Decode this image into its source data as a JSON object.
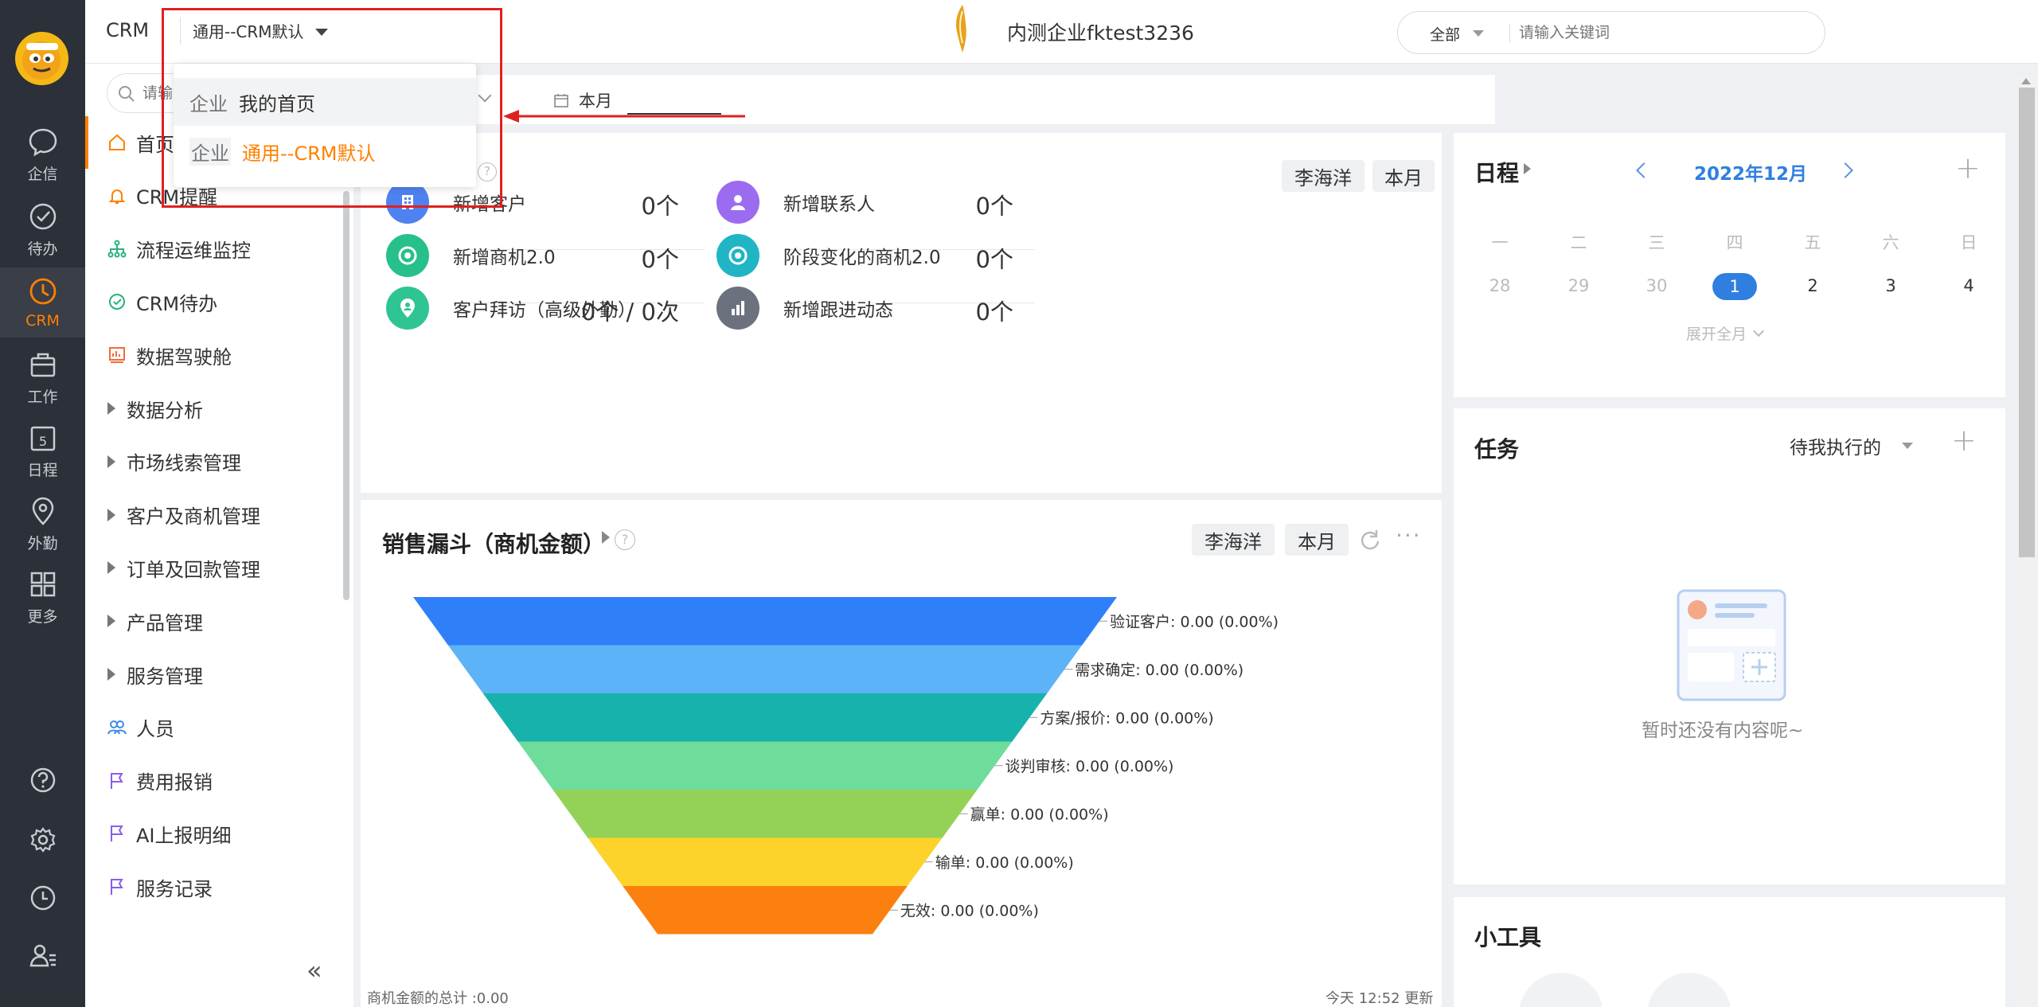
{
  "rail": {
    "items": [
      {
        "label": "企信",
        "icon": "chat-bubble-icon"
      },
      {
        "label": "待办",
        "icon": "check-circle-icon"
      },
      {
        "label": "CRM",
        "icon": "clock-icon"
      },
      {
        "label": "工作",
        "icon": "briefcase-icon"
      },
      {
        "label": "日程",
        "icon": "calendar-icon",
        "badge": "5"
      },
      {
        "label": "外勤",
        "icon": "location-pin-icon"
      },
      {
        "label": "更多",
        "icon": "grid-icon"
      }
    ],
    "active": "CRM",
    "active_color": "#ff8000"
  },
  "topbar": {
    "app_name": "CRM",
    "view_selector": "通用--CRM默认",
    "company": "内测企业fktest3236",
    "search_scope": "全部",
    "search_placeholder": "请输入关键词"
  },
  "dropdown": {
    "items": [
      {
        "tag": "企业",
        "label": "我的首页",
        "selected": false
      },
      {
        "tag": "企业",
        "label": "通用--CRM默认",
        "selected": true
      }
    ],
    "highlight_color": "#e02020"
  },
  "filterbar": {
    "search_placeholder": "请输",
    "date_label": "本月"
  },
  "menu": {
    "items": [
      {
        "label": "首页",
        "icon": "home-icon",
        "expandable": false
      },
      {
        "label": "CRM提醒",
        "icon": "bell-icon",
        "expandable": false
      },
      {
        "label": "流程运维监控",
        "icon": "flow-tree-icon",
        "expandable": false
      },
      {
        "label": "CRM待办",
        "icon": "check-circle-icon",
        "expandable": false
      },
      {
        "label": "数据驾驶舱",
        "icon": "dashboard-icon",
        "expandable": false
      },
      {
        "label": "数据分析",
        "expandable": true
      },
      {
        "label": "市场线索管理",
        "expandable": true
      },
      {
        "label": "客户及商机管理",
        "expandable": true
      },
      {
        "label": "订单及回款管理",
        "expandable": true
      },
      {
        "label": "产品管理",
        "expandable": true
      },
      {
        "label": "服务管理",
        "expandable": true
      },
      {
        "label": "人员",
        "icon": "people-icon",
        "expandable": false
      },
      {
        "label": "费用报销",
        "icon": "flag-icon",
        "expandable": false
      },
      {
        "label": "AI上报明细",
        "icon": "flag-icon",
        "expandable": false
      },
      {
        "label": "服务记录",
        "icon": "flag-icon",
        "expandable": false
      }
    ],
    "collapse_glyph": "«"
  },
  "overview": {
    "owner": "李海洋",
    "period": "本月",
    "stats": [
      {
        "label": "新增客户",
        "value": "0个",
        "icon": "building-icon",
        "color": "#4f82f0"
      },
      {
        "label": "新增联系人",
        "value": "0个",
        "icon": "person-icon",
        "color": "#9b6cf0"
      },
      {
        "label": "新增商机2.0",
        "value": "0个",
        "icon": "target-icon",
        "color": "#27c08a"
      },
      {
        "label": "阶段变化的商机2.0",
        "value": "0个",
        "icon": "target-icon",
        "color": "#1fb5c5"
      },
      {
        "label": "客户拜访（高级外勤）",
        "value": "0个 / 0次",
        "icon": "location-person-icon",
        "color": "#2fc493"
      },
      {
        "label": "新增跟进动态",
        "value": "0个",
        "icon": "bar-chart-icon",
        "color": "#6c7180"
      }
    ]
  },
  "funnel": {
    "title": "销售漏斗（商机金额）",
    "owner": "李海洋",
    "period": "本月",
    "stages": [
      {
        "label": "验证客户",
        "value": "0.00 (0.00%)",
        "color": "#2f80f8"
      },
      {
        "label": "需求确定",
        "value": "0.00 (0.00%)",
        "color": "#5cb3f7"
      },
      {
        "label": "方案/报价",
        "value": "0.00 (0.00%)",
        "color": "#17b2ac"
      },
      {
        "label": "谈判审核",
        "value": "0.00 (0.00%)",
        "color": "#6edc9b"
      },
      {
        "label": "赢单",
        "value": "0.00 (0.00%)",
        "color": "#93d257"
      },
      {
        "label": "输单",
        "value": "0.00 (0.00%)",
        "color": "#fdd22b"
      },
      {
        "label": "无效",
        "value": "0.00 (0.00%)",
        "color": "#fb8010"
      }
    ],
    "total": "商机金额的总计 :0.00",
    "updated": "今天 12:52 更新"
  },
  "schedule": {
    "title": "日程",
    "month": "2022年12月",
    "weekdays": [
      "一",
      "二",
      "三",
      "四",
      "五",
      "六",
      "日"
    ],
    "days": [
      "28",
      "29",
      "30",
      "1",
      "2",
      "3",
      "4"
    ],
    "today": "1",
    "expand_label": "展开全月",
    "accent": "#2f7fe0"
  },
  "tasks": {
    "title": "任务",
    "filter": "待我执行的",
    "empty_text": "暂时还没有内容呢~"
  },
  "tools": {
    "title": "小工具"
  }
}
